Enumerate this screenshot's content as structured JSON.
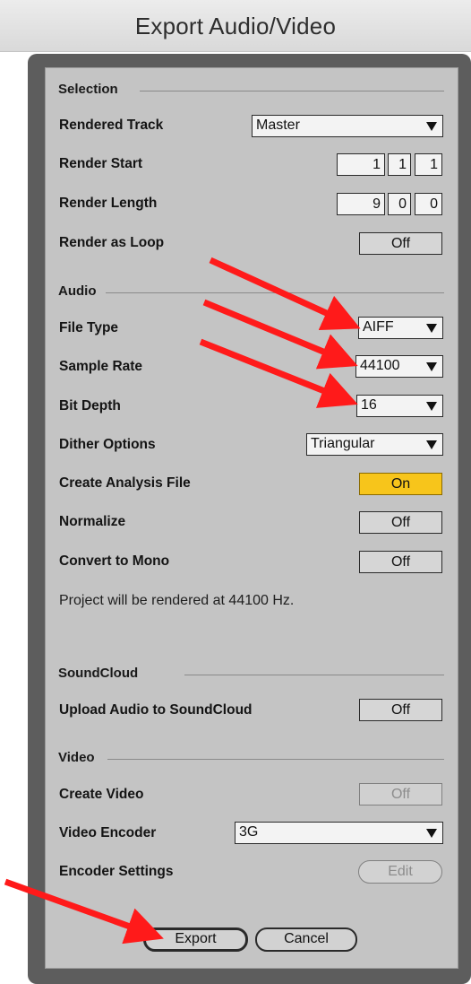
{
  "window": {
    "title": "Export Audio/Video"
  },
  "sections": {
    "selection": "Selection",
    "audio": "Audio",
    "soundcloud": "SoundCloud",
    "video": "Video"
  },
  "selection": {
    "rendered_track": {
      "label": "Rendered Track",
      "value": "Master"
    },
    "render_start": {
      "label": "Render Start",
      "values": [
        "1",
        "1",
        "1"
      ]
    },
    "render_length": {
      "label": "Render Length",
      "values": [
        "9",
        "0",
        "0"
      ]
    },
    "render_as_loop": {
      "label": "Render as Loop",
      "value": "Off"
    }
  },
  "audio": {
    "file_type": {
      "label": "File Type",
      "value": "AIFF"
    },
    "sample_rate": {
      "label": "Sample Rate",
      "value": "44100"
    },
    "bit_depth": {
      "label": "Bit Depth",
      "value": "16"
    },
    "dither_options": {
      "label": "Dither Options",
      "value": "Triangular"
    },
    "create_analysis_file": {
      "label": "Create Analysis File",
      "value": "On"
    },
    "normalize": {
      "label": "Normalize",
      "value": "Off"
    },
    "convert_to_mono": {
      "label": "Convert to Mono",
      "value": "Off"
    },
    "info": "Project will be rendered at 44100 Hz."
  },
  "soundcloud": {
    "upload": {
      "label": "Upload Audio to SoundCloud",
      "value": "Off"
    }
  },
  "video": {
    "create_video": {
      "label": "Create Video",
      "value": "Off"
    },
    "video_encoder": {
      "label": "Video Encoder",
      "value": "3G"
    },
    "encoder_settings": {
      "label": "Encoder Settings",
      "button": "Edit"
    }
  },
  "actions": {
    "export": "Export",
    "cancel": "Cancel"
  },
  "colors": {
    "toggle_on": "#f7c51b",
    "annotation_arrow": "#ff1a1a"
  }
}
